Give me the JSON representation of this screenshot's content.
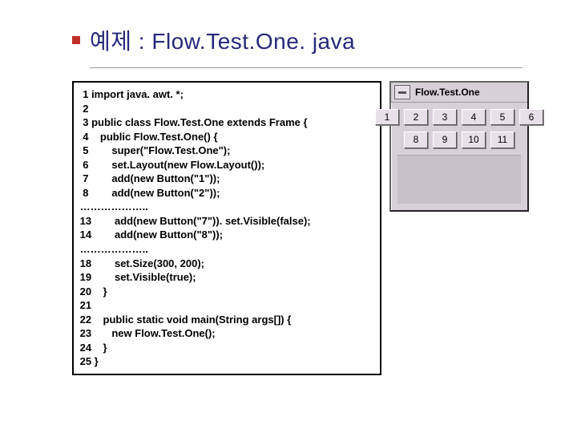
{
  "title": "예제 : Flow.Test.One. java",
  "code": {
    "lines": [
      "  1 import java. awt. *;",
      "  2",
      "  3 public class Flow.Test.One extends Frame {",
      "  4    public Flow.Test.One() {",
      "  5        super(\"Flow.Test.One\");",
      "  6        set.Layout(new Flow.Layout());",
      "  7        add(new Button(\"1\"));",
      "  8        add(new Button(\"2\"));",
      " ………………..",
      " 13        add(new Button(\"7\")). set.Visible(false);",
      " 14        add(new Button(\"8\"));",
      " ………………..",
      " 18        set.Size(300, 200);",
      " 19        set.Visible(true);",
      " 20    }",
      " 21",
      " 22    public static void main(String args[]) {",
      " 23       new Flow.Test.One();",
      " 24    }",
      " 25 }"
    ]
  },
  "window": {
    "title": "Flow.Test.One",
    "row1": [
      "1",
      "2",
      "3",
      "4",
      "5",
      "6"
    ],
    "row2": [
      "8",
      "9",
      "10",
      "11"
    ]
  }
}
